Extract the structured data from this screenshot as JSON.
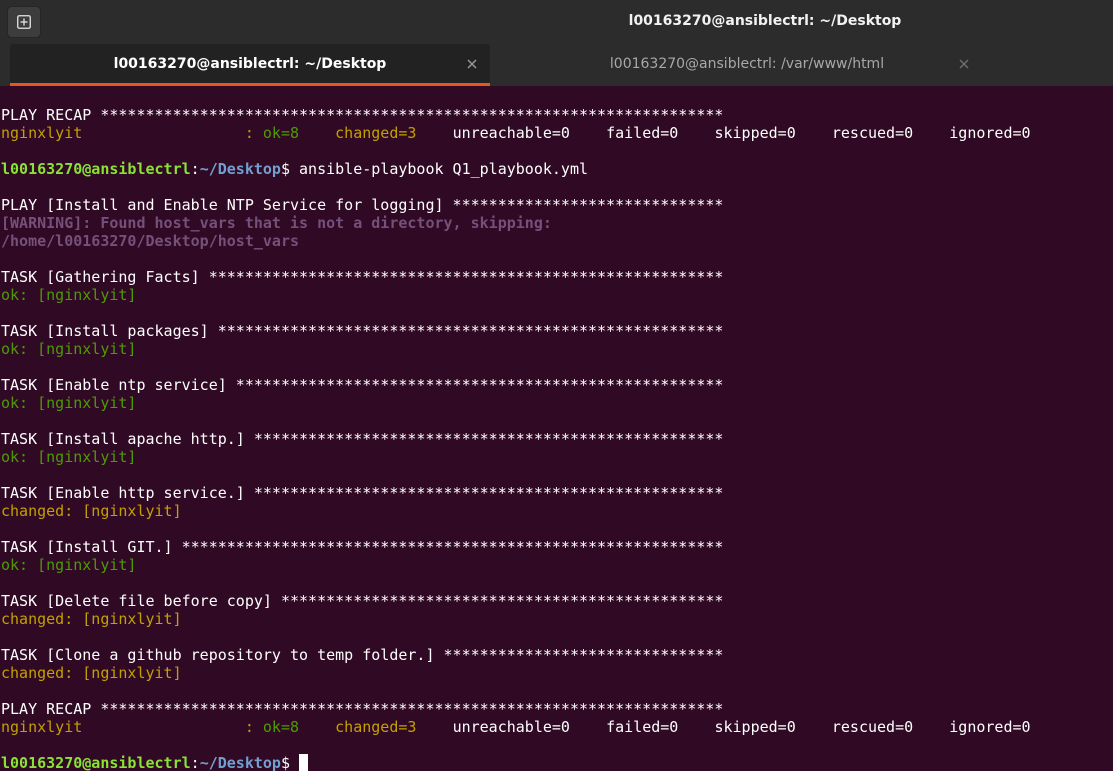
{
  "window": {
    "title": "l00163270@ansiblectrl: ~/Desktop"
  },
  "tabs": [
    {
      "label": "l00163270@ansiblectrl: ~/Desktop",
      "active": true
    },
    {
      "label": "l00163270@ansiblectrl: /var/www/html",
      "active": false
    }
  ],
  "icons": {
    "new_tab": "new-tab-icon",
    "close": "close-icon"
  },
  "colors": {
    "terminal_bg": "#300a24",
    "ok": "#4e9a06",
    "changed": "#c4a000",
    "warning": "#75507b",
    "prompt_user": "#8ae234",
    "prompt_path": "#729fcf",
    "tab_accent": "#e95420"
  },
  "terminal": {
    "recap1_header": "PLAY RECAP *********************************************************************",
    "recap1": {
      "host": "nginxlyit                  : ",
      "ok": "ok=8",
      "changed": "changed=3",
      "rest": "unreachable=0    failed=0    skipped=0    rescued=0    ignored=0"
    },
    "prompt1": {
      "user": "l00163270@ansiblectrl",
      "sep": ":",
      "path": "~/Desktop",
      "symbol": "$ ",
      "command": "ansible-playbook Q1_playbook.yml"
    },
    "play_header": "PLAY [Install and Enable NTP Service for logging] ******************************",
    "warning_line1": "[WARNING]: Found host_vars that is not a directory, skipping:",
    "warning_line2": "/home/l00163270/Desktop/host_vars",
    "tasks": [
      {
        "header": "TASK [Gathering Facts] *********************************************************",
        "result": "ok: [nginxlyit]",
        "status": "ok"
      },
      {
        "header": "TASK [Install packages] ********************************************************",
        "result": "ok: [nginxlyit]",
        "status": "ok"
      },
      {
        "header": "TASK [Enable ntp service] ******************************************************",
        "result": "ok: [nginxlyit]",
        "status": "ok"
      },
      {
        "header": "TASK [Install apache http.] ****************************************************",
        "result": "ok: [nginxlyit]",
        "status": "ok"
      },
      {
        "header": "TASK [Enable http service.] ****************************************************",
        "result": "changed: [nginxlyit]",
        "status": "changed"
      },
      {
        "header": "TASK [Install GIT.] ************************************************************",
        "result": "ok: [nginxlyit]",
        "status": "ok"
      },
      {
        "header": "TASK [Delete file before copy] *************************************************",
        "result": "changed: [nginxlyit]",
        "status": "changed"
      },
      {
        "header": "TASK [Clone a github repository to temp folder.] *******************************",
        "result": "changed: [nginxlyit]",
        "status": "changed"
      }
    ],
    "recap2_header": "PLAY RECAP *********************************************************************",
    "recap2": {
      "host": "nginxlyit                  : ",
      "ok": "ok=8",
      "changed": "changed=3",
      "rest": "unreachable=0    failed=0    skipped=0    rescued=0    ignored=0"
    },
    "prompt2": {
      "user": "l00163270@ansiblectrl",
      "sep": ":",
      "path": "~/Desktop",
      "symbol": "$"
    }
  }
}
